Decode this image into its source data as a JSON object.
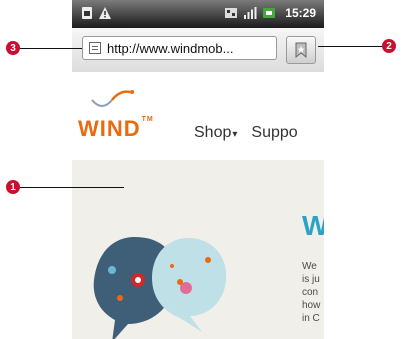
{
  "statusbar": {
    "time": "15:29"
  },
  "browser": {
    "url": "http://www.windmob..."
  },
  "site": {
    "logo_text": "WIND",
    "trademark": "TM",
    "nav": [
      {
        "label": "Shop",
        "caret": "▾"
      },
      {
        "label": "Suppo"
      }
    ],
    "hero_letter": "W",
    "hero_text": "We\nis ju\ncon\nhow\nin C"
  },
  "callouts": {
    "one": "1",
    "two": "2",
    "three": "3"
  }
}
